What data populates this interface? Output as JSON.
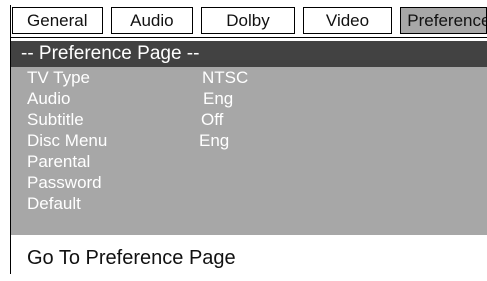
{
  "tabs": [
    {
      "label": "General"
    },
    {
      "label": "Audio"
    },
    {
      "label": "Dolby"
    },
    {
      "label": "Video"
    },
    {
      "label": "Preference"
    }
  ],
  "page_title": "-- Preference Page --",
  "menu": [
    {
      "label": "TV Type",
      "value": "NTSC"
    },
    {
      "label": "Audio",
      "value": "Eng"
    },
    {
      "label": "Subtitle",
      "value": "Off"
    },
    {
      "label": "Disc Menu",
      "value": "Eng"
    },
    {
      "label": "Parental",
      "value": ""
    },
    {
      "label": "Password",
      "value": ""
    },
    {
      "label": "Default",
      "value": ""
    }
  ],
  "status_text": "Go To Preference Page",
  "colors": {
    "panel": "#a7a7a7",
    "header": "#424242",
    "active_tab": "#a7a7a7"
  }
}
